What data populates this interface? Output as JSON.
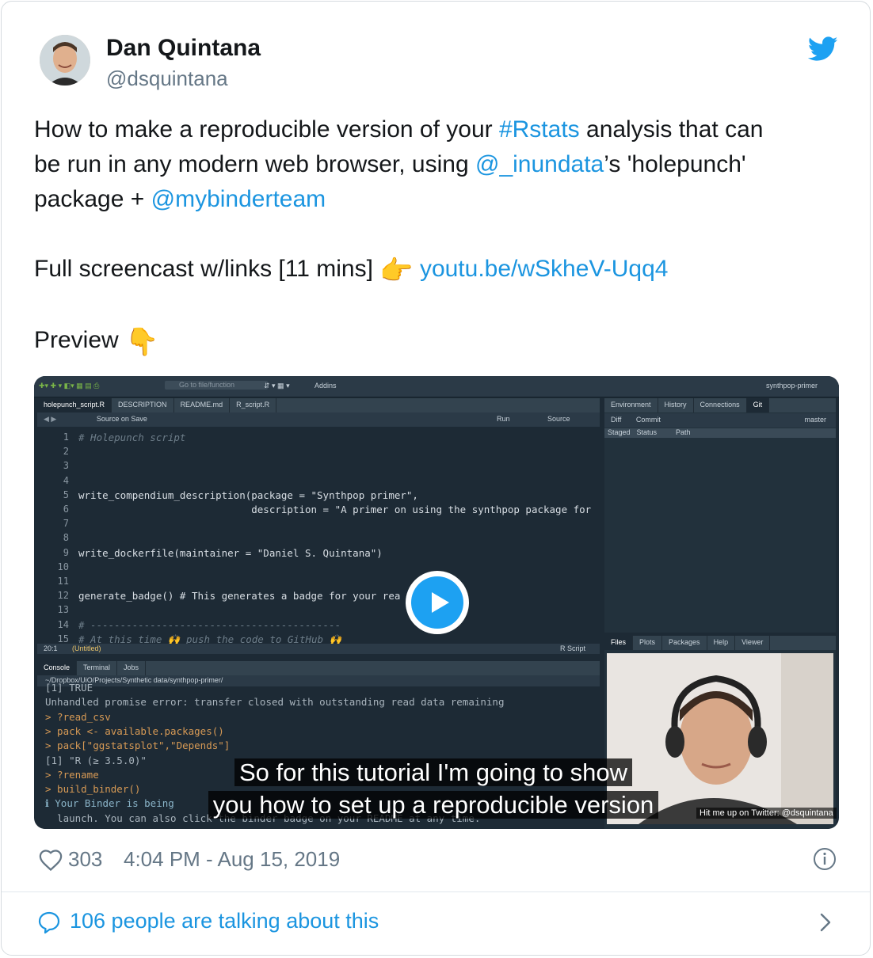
{
  "author": {
    "name": "Dan Quintana",
    "handle": "@dsquintana"
  },
  "tweet": {
    "line1_pre": "How to make a reproducible version of your ",
    "hashtag": "#Rstats",
    "line1_post": " analysis that can",
    "line2_pre": "be run in any modern web browser, using ",
    "mention1": "@_inundata",
    "line2_post": "’s 'holepunch'",
    "line3_pre": "package + ",
    "mention2": "@mybinderteam",
    "screencast_pre": "Full screencast w/links [11 mins] ",
    "pointing_right_emoji": "👉",
    "url": "youtu.be/wSkheV-Uqq4",
    "preview_label": "Preview ",
    "pointing_down_emoji": "👇"
  },
  "video": {
    "rstudio_toolbar": {
      "goto": "Go to file/function",
      "addins": "Addins",
      "project": "synthpop-primer"
    },
    "editor_tabs": [
      "holepunch_script.R",
      "DESCRIPTION",
      "README.md",
      "R_script.R"
    ],
    "editor_toolbar": {
      "source_on_save": "Source on Save",
      "run": "Run",
      "source": "Source"
    },
    "code_lines": [
      {
        "n": "1",
        "text": "# Holepunch script",
        "kind": "comment"
      },
      {
        "n": "2",
        "text": "",
        "kind": "code"
      },
      {
        "n": "3",
        "text": "",
        "kind": "code"
      },
      {
        "n": "4",
        "text": "",
        "kind": "code"
      },
      {
        "n": "5",
        "text": "write_compendium_description(package = \"Synthpop primer\",",
        "kind": "code"
      },
      {
        "n": "6",
        "text": "                             description = \"A primer on using the synthpop package for",
        "kind": "code"
      },
      {
        "n": "7",
        "text": "",
        "kind": "code"
      },
      {
        "n": "8",
        "text": "",
        "kind": "code"
      },
      {
        "n": "9",
        "text": "write_dockerfile(maintainer = \"Daniel S. Quintana\")",
        "kind": "code"
      },
      {
        "n": "10",
        "text": "",
        "kind": "code"
      },
      {
        "n": "11",
        "text": "",
        "kind": "code"
      },
      {
        "n": "12",
        "text": "generate_badge() # This generates a badge for your rea",
        "kind": "code"
      },
      {
        "n": "13",
        "text": "",
        "kind": "code"
      },
      {
        "n": "14",
        "text": "# ------------------------------------------",
        "kind": "comment"
      },
      {
        "n": "15",
        "text": "# At this time 🙌 push the code to GitHub 🙌",
        "kind": "comment"
      }
    ],
    "editor_status": {
      "position": "20:1",
      "scope": "(Untitled)",
      "filetype": "R Script"
    },
    "console_tabs": [
      "Console",
      "Terminal",
      "Jobs"
    ],
    "console_path": "~/Dropbox/UiO/Projects/Synthetic data/synthpop-primer/",
    "console_lines": [
      {
        "text": "[1] TRUE",
        "kind": "out"
      },
      {
        "text": "Unhandled promise error: transfer closed with outstanding read data remaining",
        "kind": "out"
      },
      {
        "text": "> ?read_csv",
        "kind": "prompt"
      },
      {
        "text": "> pack <- available.packages()",
        "kind": "prompt"
      },
      {
        "text": "> pack[\"ggstatsplot\",\"Depends\"]",
        "kind": "prompt"
      },
      {
        "text": "[1] \"R (≥ 3.5.0)\"",
        "kind": "out"
      },
      {
        "text": "> ?rename",
        "kind": "prompt"
      },
      {
        "text": "> build_binder()",
        "kind": "prompt"
      },
      {
        "text": "ℹ Your Binder is being",
        "kind": "info"
      },
      {
        "text": "  launch. You can also click the binder badge on your README at any time.",
        "kind": "out"
      }
    ],
    "env_tabs": [
      "Environment",
      "History",
      "Connections",
      "Git"
    ],
    "git_toolbar": {
      "diff": "Diff",
      "commit": "Commit",
      "branch": "master"
    },
    "git_headers": [
      "Staged",
      "Status",
      "Path"
    ],
    "files_tabs": [
      "Files",
      "Plots",
      "Packages",
      "Help",
      "Viewer"
    ],
    "webcam_caption": "Hit me up on Twitter: @dsquintana",
    "subtitle_line1": "So for this tutorial I'm going to show",
    "subtitle_line2": "you how to set up a  reproducible version"
  },
  "footer": {
    "likes": "303",
    "timestamp": "4:04 PM - Aug 15, 2019",
    "talking": "106 people are talking about this"
  },
  "colors": {
    "link": "#1b95e0",
    "twitter_blue": "#1da1f2",
    "muted": "#657786"
  }
}
